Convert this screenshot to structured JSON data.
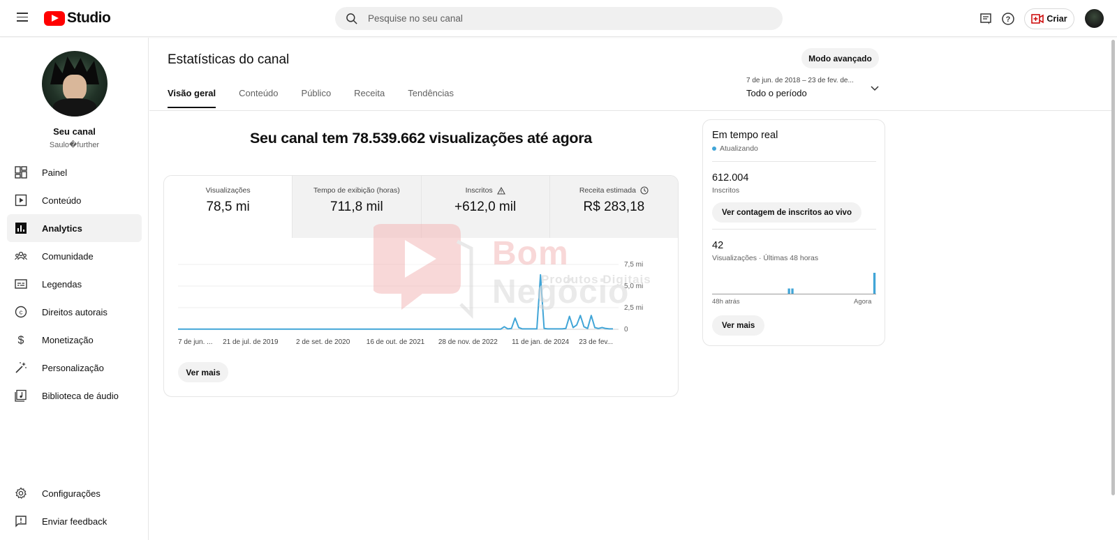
{
  "header": {
    "logo_text": "Studio",
    "search_placeholder": "Pesquise no seu canal",
    "create_label": "Criar"
  },
  "sidebar": {
    "channel_name": "Seu canal",
    "channel_handle": "Saulo�further",
    "items": [
      {
        "label": "Painel",
        "icon": "dashboard-icon"
      },
      {
        "label": "Conteúdo",
        "icon": "content-icon"
      },
      {
        "label": "Analytics",
        "icon": "analytics-icon",
        "active": true
      },
      {
        "label": "Comunidade",
        "icon": "community-icon"
      },
      {
        "label": "Legendas",
        "icon": "subtitles-icon"
      },
      {
        "label": "Direitos autorais",
        "icon": "copyright-icon"
      },
      {
        "label": "Monetização",
        "icon": "monetization-icon"
      },
      {
        "label": "Personalização",
        "icon": "customization-icon"
      },
      {
        "label": "Biblioteca de áudio",
        "icon": "audio-library-icon"
      }
    ],
    "bottom_items": [
      {
        "label": "Configurações",
        "icon": "settings-icon"
      },
      {
        "label": "Enviar feedback",
        "icon": "feedback-icon"
      }
    ]
  },
  "main": {
    "title": "Estatísticas do canal",
    "advanced_mode": "Modo avançado",
    "date_range": {
      "sub": "7 de jun. de 2018 – 23 de fev. de...",
      "main": "Todo o período"
    },
    "tabs": [
      "Visão geral",
      "Conteúdo",
      "Público",
      "Receita",
      "Tendências"
    ],
    "headline": "Seu canal tem 78.539.662 visualizações até agora",
    "metrics": [
      {
        "label": "Visualizações",
        "value": "78,5 mi"
      },
      {
        "label": "Tempo de exibição (horas)",
        "value": "711,8 mil"
      },
      {
        "label": "Inscritos",
        "value": "+612,0 mil"
      },
      {
        "label": "Receita estimada",
        "value": "R$ 283,18"
      }
    ],
    "see_more": "Ver mais"
  },
  "chart_data": {
    "type": "line",
    "x_tick_labels": [
      "7 de jun. ...",
      "21 de jul. de 2019",
      "2 de set. de 2020",
      "16 de out. de 2021",
      "28 de nov. de 2022",
      "11 de jan. de 2024",
      "23 de fev..."
    ],
    "y_tick_labels": [
      "7,5 mi",
      "5,0 mi",
      "2,5 mi",
      "0"
    ],
    "ylim": [
      0,
      7.5
    ],
    "series": [
      {
        "values": [
          0.02,
          0.02,
          0.02,
          0.02,
          0.02,
          0.02,
          0.02,
          0.02,
          0.02,
          0.02,
          0.02,
          0.02,
          0.02,
          0.02,
          0.02,
          0.02,
          0.02,
          0.02,
          0.02,
          0.02,
          0.02,
          0.02,
          0.02,
          0.02,
          0.02,
          0.02,
          0.02,
          0.02,
          0.02,
          0.02,
          0.02,
          0.02,
          0.02,
          0.02,
          0.02,
          0.02,
          0.02,
          0.02,
          0.02,
          0.02,
          0.02,
          0.02,
          0.02,
          0.02,
          0.02,
          0.02,
          0.02,
          0.02,
          0.02,
          0.02,
          0.02,
          0.02,
          0.02,
          0.02,
          0.02,
          0.02,
          0.02,
          0.02,
          0.02,
          0.02,
          0.02,
          0.02,
          0.02,
          0.02,
          0.02,
          0.02,
          0.02,
          0.02,
          0.02,
          0.02,
          0.02,
          0.02,
          0.02,
          0.02,
          0.02,
          0.02,
          0.02,
          0.02,
          0.02,
          0.02,
          0.02,
          0.02,
          0.02,
          0.02,
          0.02,
          0.02,
          0.02,
          0.02,
          0.02,
          0.02,
          0.3,
          0.05,
          0.1,
          1.3,
          0.2,
          0.05,
          0.05,
          0.05,
          0.05,
          0.05,
          6.3,
          0.1,
          0.05,
          0.05,
          0.05,
          0.05,
          0.05,
          0.1,
          1.5,
          0.2,
          0.5,
          1.6,
          0.3,
          0.1,
          1.6,
          0.2,
          0.1,
          0.2,
          0.1,
          0.05,
          0.05
        ]
      }
    ]
  },
  "realtime": {
    "title": "Em tempo real",
    "status": "Atualizando",
    "subscribers_value": "612.004",
    "subscribers_label": "Inscritos",
    "live_count_button": "Ver contagem de inscritos ao vivo",
    "views_value": "42",
    "views_label": "Visualizações · Últimas 48 horas",
    "axis_start": "48h atrás",
    "axis_end": "Agora",
    "see_more": "Ver mais",
    "chart_data": {
      "type": "bar",
      "values": [
        0,
        0,
        0,
        0,
        0,
        0,
        0,
        0,
        0,
        0,
        0,
        0,
        0,
        0,
        0,
        0,
        0,
        0,
        0,
        0,
        0,
        0,
        1,
        1,
        0,
        0,
        0,
        0,
        0,
        0,
        0,
        0,
        0,
        0,
        0,
        0,
        0,
        0,
        0,
        0,
        0,
        0,
        0,
        0,
        0,
        0,
        0,
        4
      ]
    }
  },
  "watermark": {
    "text_a": "Bom ",
    "text_b": "Negócio",
    "sub": "Produtos Digitais"
  },
  "colors": {
    "accent": "#41a5d7",
    "brand_red": "#ff0000"
  }
}
